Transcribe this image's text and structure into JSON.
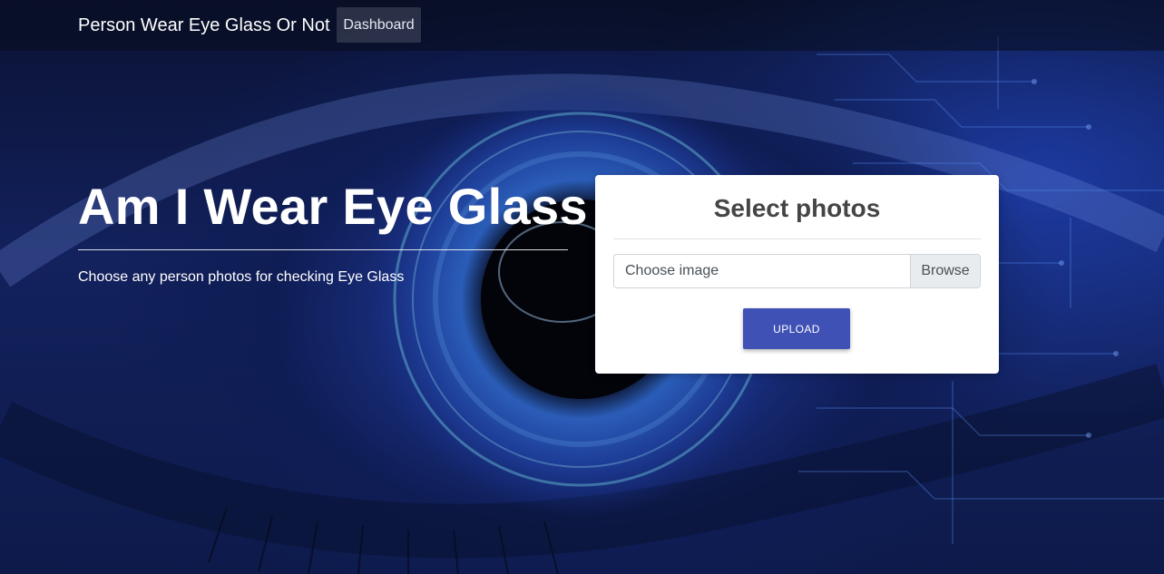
{
  "navbar": {
    "brand": "Person Wear Eye Glass Or Not",
    "links": [
      {
        "label": "Dashboard"
      }
    ]
  },
  "hero": {
    "title": "Am I Wear Eye Glass",
    "subtitle": "Choose any person photos for checking Eye Glass"
  },
  "upload_card": {
    "title": "Select photos",
    "file_input": {
      "label": "Choose image",
      "browse_label": "Browse"
    },
    "upload_button": "UPLOAD"
  },
  "colors": {
    "accent": "#3f51b5",
    "background": "#13215d",
    "card": "#ffffff"
  },
  "background_image": "eye-with-circuit-lines"
}
